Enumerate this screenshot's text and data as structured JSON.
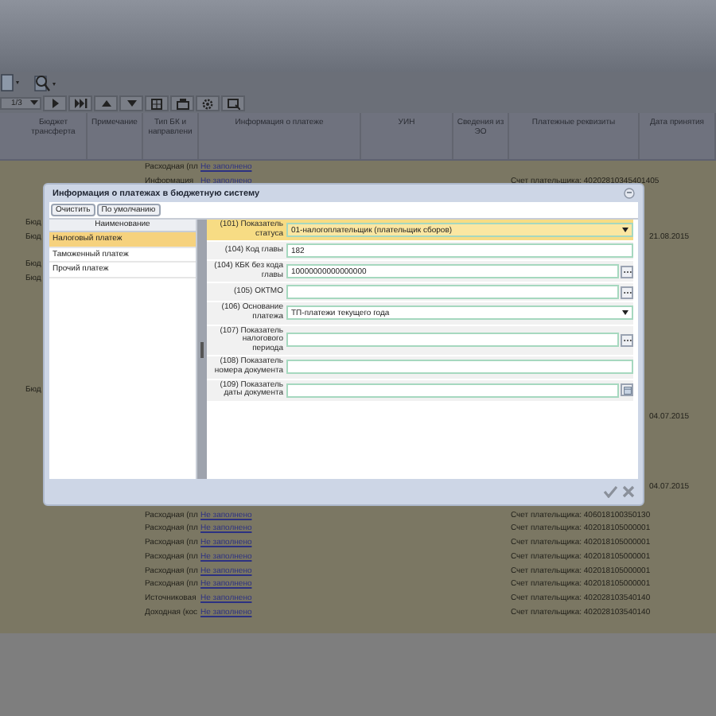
{
  "table": {
    "columns": [
      "Бюджет трансферта",
      "Примечание",
      "Тип БК и направлени",
      "Информация о платеже",
      "УИН",
      "Сведения из ЭО",
      "Платежные реквизиты",
      "Дата принятия"
    ],
    "pager": {
      "page": "1/3"
    },
    "rows": [
      {
        "type": "Расходная (пл",
        "note": "Не заполнено"
      },
      {
        "type": "Информация",
        "note": "Не заполнено",
        "account": "Счет плательщика: 40202810345401405"
      },
      {},
      {},
      {
        "budget": "Бюд"
      },
      {
        "budget": "Бюд",
        "date": "21.08.2015"
      },
      {},
      {
        "budget": "Бюд"
      },
      {
        "budget": "Бюд"
      },
      {},
      {},
      {},
      {},
      {},
      {},
      {},
      {
        "budget": "Бюд"
      },
      {},
      {
        "date": "04.07.2015"
      },
      {},
      {},
      {},
      {},
      {
        "date": "04.07.2015"
      },
      {},
      {
        "type": "Расходная (пл",
        "note": "Не заполнено",
        "account": "Счет плательщика: 406018100350130"
      },
      {
        "type": "Расходная (пл",
        "note": "Не заполнено",
        "account": "Счет плательщика: 402018105000001"
      },
      {
        "type": "Расходная (пл",
        "note": "Не заполнено",
        "account": "Счет плательщика: 402018105000001"
      },
      {
        "type": "Расходная (пл",
        "note": "Не заполнено",
        "account": "Счет плательщика: 402018105000001"
      },
      {
        "type": "Расходная (пл",
        "note": "Не заполнено",
        "account": "Счет плательщика: 402018105000001"
      },
      {
        "type": "Расходная (пл",
        "note": "Не заполнено",
        "account": "Счет плательщика: 402018105000001"
      },
      {
        "type": "Источниковая",
        "note": "Не заполнено",
        "account": "Счет плательщика: 402028103540140"
      },
      {
        "type": "Доходная (кос",
        "note": "Не заполнено",
        "account": "Счет плательщика: 402028103540140"
      }
    ]
  },
  "dialog": {
    "title": "Информация о платежах в бюджетную систему",
    "buttons": [
      "Очистить",
      "По умолчанию"
    ],
    "list": {
      "heading": "Наименование",
      "items": [
        {
          "label": "Налоговый платеж",
          "selected": true
        },
        {
          "label": "Таможенный платеж",
          "selected": false
        },
        {
          "label": "Прочий платеж",
          "selected": false
        }
      ]
    },
    "fields": [
      {
        "label": "(101) Показатель статуса",
        "kind": "select",
        "value": "01-налогоплательщик (плательщик сборов)",
        "focused": true
      },
      {
        "label": "(104) Код главы",
        "kind": "text",
        "value": "182",
        "focused": false
      },
      {
        "label": "(104) КБК без кода главы",
        "kind": "lookup",
        "value": "10000000000000000",
        "focused": false
      },
      {
        "label": "(105) ОКТМО",
        "kind": "lookup",
        "focused": false
      },
      {
        "label": "(106) Основание платежа",
        "kind": "select",
        "value": "ТП-платежи текущего года",
        "focused": false
      },
      {
        "label": "(107) Показатель налогового периода",
        "kind": "lookup",
        "focused": false
      },
      {
        "label": "(108) Показатель номера документа",
        "kind": "text",
        "focused": false
      },
      {
        "label": "(109) Показатель даты документа",
        "kind": "date",
        "focused": false
      }
    ]
  }
}
